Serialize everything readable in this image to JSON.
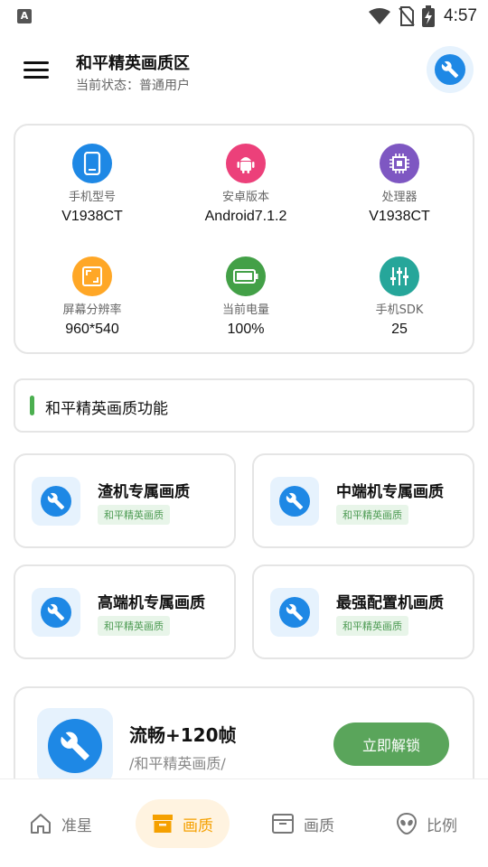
{
  "status_bar": {
    "keyboard_indicator": "A",
    "time": "4:57"
  },
  "header": {
    "title": "和平精英画质区",
    "subtitle": "当前状态：普通用户"
  },
  "device_info": [
    {
      "label": "手机型号",
      "value": "V1938CT",
      "color": "#1e88e5",
      "icon": "phone-icon"
    },
    {
      "label": "安卓版本",
      "value": "Android7.1.2",
      "color": "#ec407a",
      "icon": "android-icon"
    },
    {
      "label": "处理器",
      "value": "V1938CT",
      "color": "#7e57c2",
      "icon": "chip-icon"
    },
    {
      "label": "屏幕分辨率",
      "value": "960*540",
      "color": "#ffa726",
      "icon": "resolution-icon"
    },
    {
      "label": "当前电量",
      "value": "100%",
      "color": "#43a047",
      "icon": "battery-icon"
    },
    {
      "label": "手机SDK",
      "value": "25",
      "color": "#26a69a",
      "icon": "equalizer-icon"
    }
  ],
  "section": {
    "title": "和平精英画质功能"
  },
  "features": [
    {
      "title": "渣机专属画质",
      "tag": "和平精英画质"
    },
    {
      "title": "中端机专属画质",
      "tag": "和平精英画质"
    },
    {
      "title": "高端机专属画质",
      "tag": "和平精英画质"
    },
    {
      "title": "最强配置机画质",
      "tag": "和平精英画质"
    }
  ],
  "promo": {
    "title": "流畅+120帧",
    "subtitle": "/和平精英画质/",
    "button_label": "立即解锁"
  },
  "bottom_nav": [
    {
      "label": "准星",
      "icon": "home-icon",
      "active": false
    },
    {
      "label": "画质",
      "icon": "box-icon",
      "active": true
    },
    {
      "label": "画质",
      "icon": "archive-icon",
      "active": false
    },
    {
      "label": "比例",
      "icon": "alien-icon",
      "active": false
    }
  ],
  "colors": {
    "accent_blue": "#1e88e5",
    "accent_green": "#5aa55b",
    "active_nav": "#f5a000"
  }
}
